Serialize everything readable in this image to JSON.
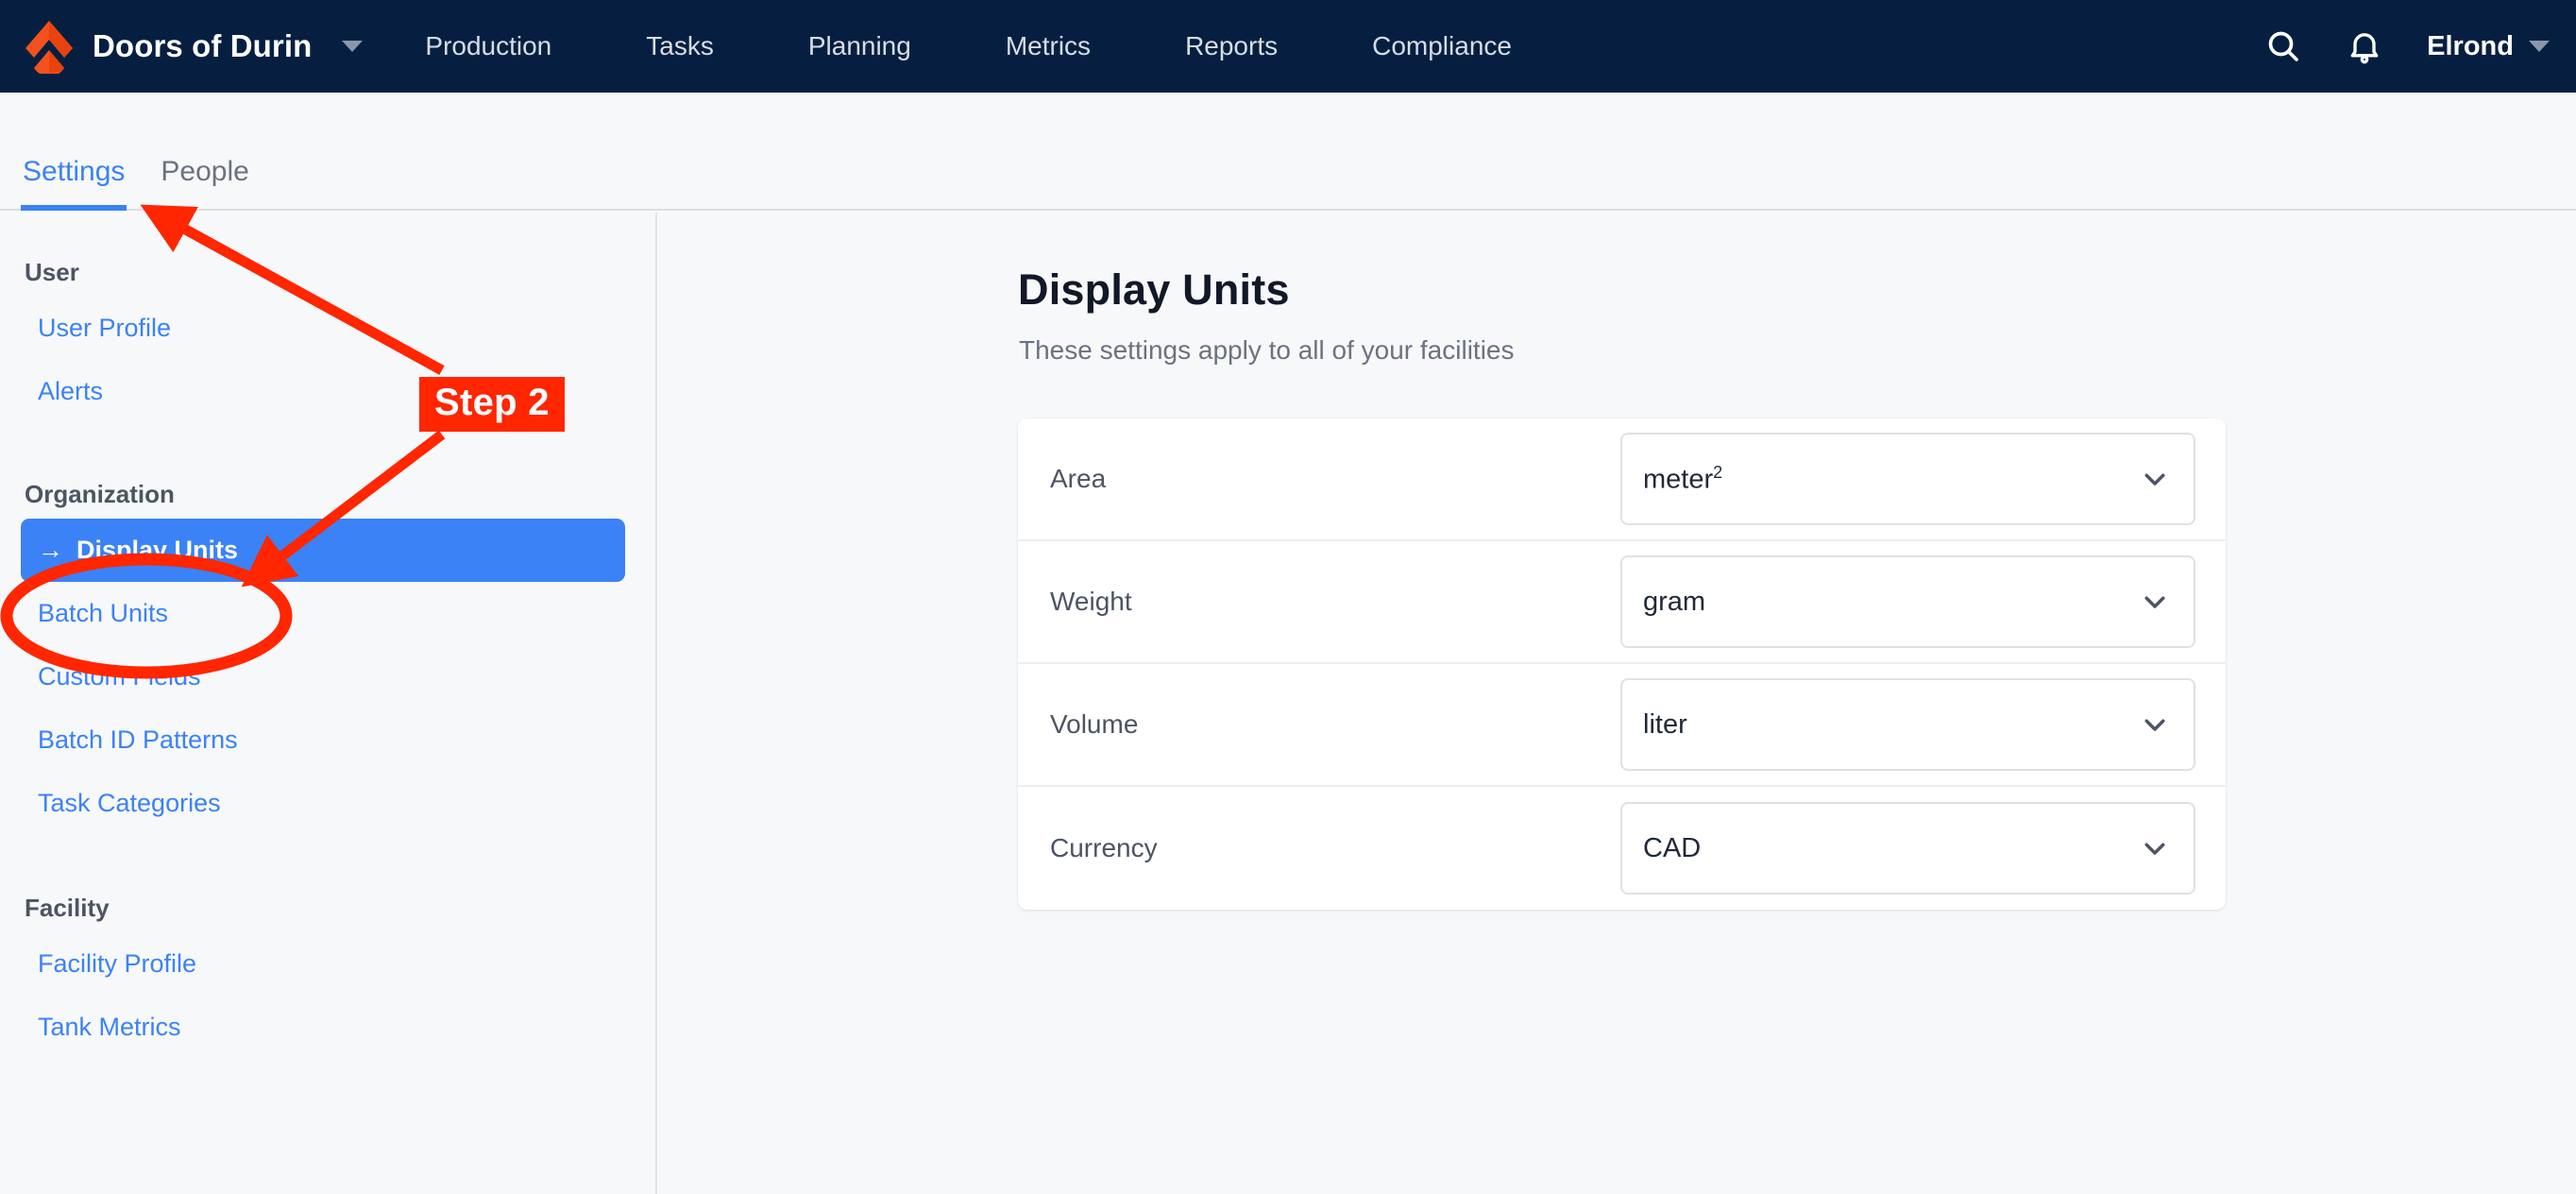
{
  "topnav": {
    "logo_icon": "chevron-flame-logo",
    "brand": "Doors of Durin",
    "brand_caret_icon": "caret-down-icon",
    "links": [
      {
        "label": "Production"
      },
      {
        "label": "Tasks"
      },
      {
        "label": "Planning"
      },
      {
        "label": "Metrics"
      },
      {
        "label": "Reports"
      },
      {
        "label": "Compliance"
      }
    ],
    "search_icon": "search-icon",
    "notifications_icon": "bell-icon",
    "user": "Elrond",
    "user_caret_icon": "caret-down-icon"
  },
  "tabs": [
    {
      "label": "Settings",
      "active": true
    },
    {
      "label": "People",
      "active": false
    }
  ],
  "sidebar": {
    "groups": [
      {
        "label": "User",
        "items": [
          {
            "label": "User Profile",
            "active": false
          },
          {
            "label": "Alerts",
            "active": false
          }
        ]
      },
      {
        "label": "Organization",
        "items": [
          {
            "label": "Display Units",
            "active": true,
            "prefix": "→"
          },
          {
            "label": "Batch Units",
            "active": false
          },
          {
            "label": "Custom Fields",
            "active": false
          },
          {
            "label": "Batch ID Patterns",
            "active": false
          },
          {
            "label": "Task Categories",
            "active": false
          }
        ]
      },
      {
        "label": "Facility",
        "items": [
          {
            "label": "Facility Profile",
            "active": false
          },
          {
            "label": "Tank Metrics",
            "active": false
          }
        ]
      }
    ]
  },
  "main": {
    "title": "Display Units",
    "subtitle": "These settings apply to all of your facilities",
    "settings": [
      {
        "label": "Area",
        "value": "meter",
        "superscript": "2",
        "dropdown_icon": "chevron-down-icon"
      },
      {
        "label": "Weight",
        "value": "gram",
        "superscript": "",
        "dropdown_icon": "chevron-down-icon"
      },
      {
        "label": "Volume",
        "value": "liter",
        "superscript": "",
        "dropdown_icon": "chevron-down-icon"
      },
      {
        "label": "Currency",
        "value": "CAD",
        "superscript": "",
        "dropdown_icon": "chevron-down-icon"
      }
    ]
  },
  "annotations": {
    "step_label": "Step 2",
    "highlight_ellipse_target": "Display Units",
    "arrow_up_target": "Settings tab",
    "arrow_down_target": "Display Units sidebar item"
  },
  "colors": {
    "topnav_bg": "#061f41",
    "brand_orange": "#f4511e",
    "accent_blue": "#3b82f6",
    "page_bg": "#f7f8fa",
    "card_bg": "#ffffff",
    "annotation_red": "#ff2600",
    "text_dark": "#111827",
    "text_muted": "#6b7280"
  }
}
